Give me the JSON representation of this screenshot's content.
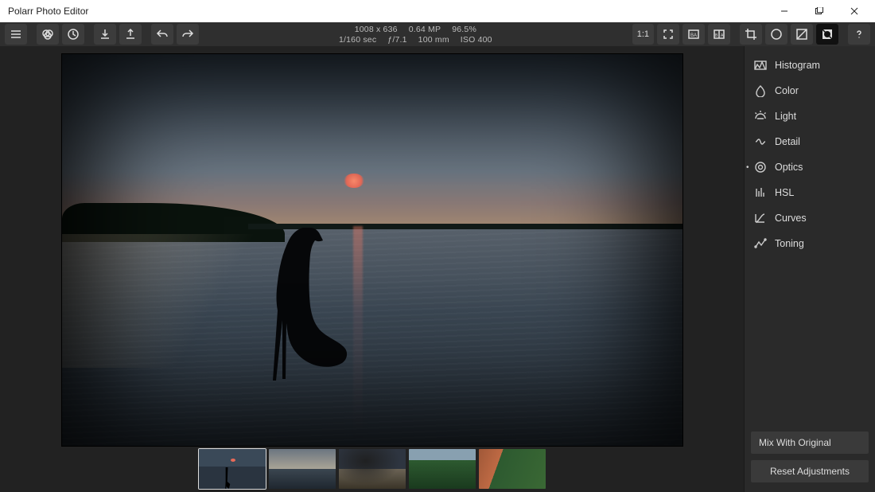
{
  "titlebar": {
    "title": "Polarr Photo Editor"
  },
  "toolbar": {
    "info_top": {
      "dimensions": "1008 x 636",
      "megapixels": "0.64 MP",
      "zoom": "96.5%"
    },
    "info_bottom": {
      "shutter": "1/160 sec",
      "aperture": "ƒ/7.1",
      "focal": "100 mm",
      "iso": "ISO 400"
    },
    "ratio_label": "1:1"
  },
  "sidebar": {
    "items": [
      {
        "label": "Histogram"
      },
      {
        "label": "Color"
      },
      {
        "label": "Light"
      },
      {
        "label": "Detail"
      },
      {
        "label": "Optics"
      },
      {
        "label": "HSL"
      },
      {
        "label": "Curves"
      },
      {
        "label": "Toning"
      }
    ],
    "mix_label": "Mix With Original",
    "reset_label": "Reset Adjustments"
  },
  "thumbnails": [
    {
      "selected": true
    },
    {
      "selected": false
    },
    {
      "selected": false
    },
    {
      "selected": false
    },
    {
      "selected": false
    }
  ]
}
